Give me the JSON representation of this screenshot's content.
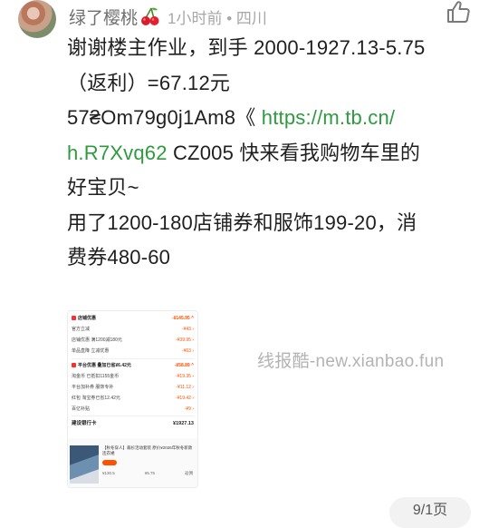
{
  "comment": {
    "username": "绿了樱桃",
    "time": "1小时前",
    "separator": "•",
    "location": "四川",
    "line1": "谢谢楼主作业，到手 2000-1927.13-5.75",
    "line2": "（返利）=67.12元",
    "line3_code": "57₴Om79g0j1Am8《 ",
    "link_part1": "https://m.tb.cn/",
    "link_part2": "h.R7Xvq62",
    "line4_rest": "  CZ005 快来看我购物车里的",
    "line5": "好宝贝~",
    "line6": "用了1200-180店铺券和服饰199-20，消",
    "line7": "费券480-60"
  },
  "colors": {
    "link": "#2d9b3e",
    "username": "#6f6f6f",
    "meta": "#a7a7a7",
    "accent": "#ff5000"
  },
  "icons": {
    "like": "thumb-up-icon",
    "cherry": "cherry-emoji-icon"
  },
  "screenshot": {
    "store_section": "店铺优惠",
    "store_total": "-¥145.95 ^",
    "rows_store": [
      {
        "label": "官方立减",
        "value": "-¥43 ›"
      },
      {
        "label": "店铺优惠  满1200减180元",
        "value": "-¥39.95 ›"
      },
      {
        "label": "单品直降  立减优惠",
        "value": "-¥63 ›"
      }
    ],
    "platform_section": "平台优惠  叠加已省¥6.42元",
    "platform_total": "-¥58.89 ^",
    "rows_platform": [
      {
        "label": "淘金币  已抵扣1155金币",
        "value": "-¥19.35 ›"
      },
      {
        "label": "平台加补券  服饰专补",
        "value": "-¥11.12 ›"
      },
      {
        "label": "红包  淘宝券已省12.42元",
        "value": "-¥19.42 ›"
      },
      {
        "label": "百亿补贴",
        "value": "-¥9 ›"
      }
    ],
    "bank_label": "建设银行卡",
    "bank_total": "¥1927.13",
    "product_title": "【秋冬穿人】裁衫活动套装  原价¥2026年秋冬新款连衣裙",
    "product_nums": [
      "¥130.5",
      "¥5.75",
      "返佣"
    ]
  },
  "watermark": "线报酷-new.xianbao.fun",
  "reply_count": "9/1页"
}
